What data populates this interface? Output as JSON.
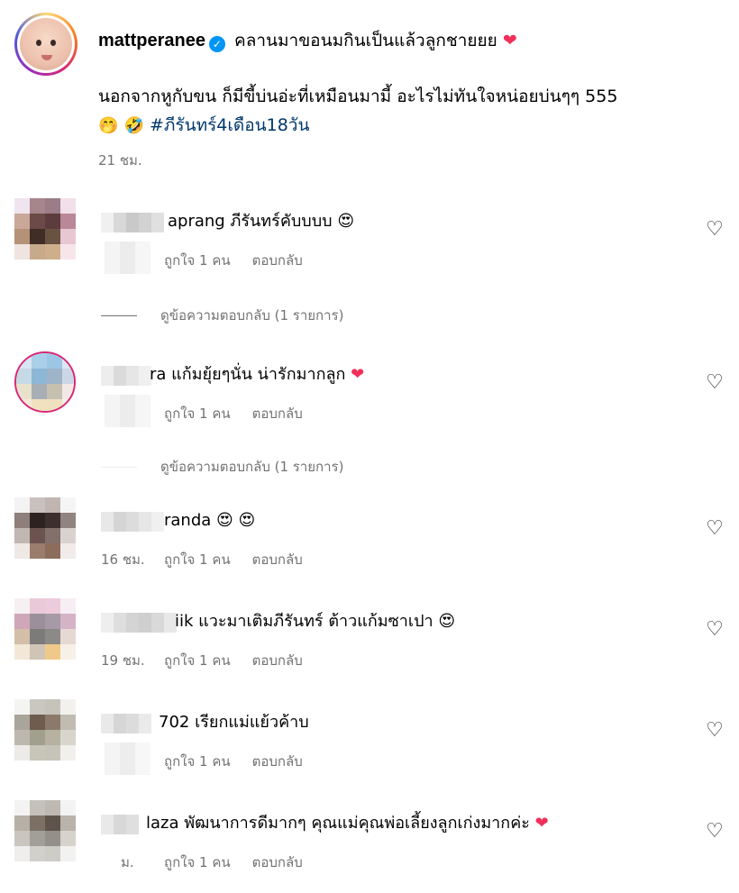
{
  "post": {
    "username": "mattperanee",
    "verified_icon": "verified-badge-icon",
    "caption_line1": "คลานมาขอนมกินเป็นแล้วลูกชายยย",
    "caption_line1_emoji": "❤",
    "caption_line2": "นอกจากหูกับขน ก็มีขี้บ่นอ่ะที่เหมือนมามี้ อะไรไม่ทันใจหน่อยบ่นๆๆ 555",
    "caption_emoji_1": "🤭",
    "caption_emoji_2": "🤣",
    "hashtag": "#ภีรันทร์4เดือน18วัน",
    "time": "21 ชม."
  },
  "comments": [
    {
      "name_suffix": "aprang",
      "text": "ภีรันทร์คับบบบ",
      "emoji": "😍",
      "time": "",
      "likes": "ถูกใจ 1 คน",
      "reply": "ตอบกลับ",
      "view_replies": "ดูข้อความตอบกลับ (1 รายการ)"
    },
    {
      "name_suffix": "ra",
      "text": "แก้มยุ้ยๆนั่น น่ารักมากลูก",
      "emoji": "❤",
      "time": "",
      "likes": "ถูกใจ 1 คน",
      "reply": "ตอบกลับ",
      "view_replies": "ดูข้อความตอบกลับ (1 รายการ)"
    },
    {
      "name_suffix": "randa",
      "text": "",
      "emoji": "😍 😍",
      "time": "16 ชม.",
      "likes": "ถูกใจ 1 คน",
      "reply": "ตอบกลับ"
    },
    {
      "name_suffix": "iik",
      "text": "แวะมาเติมภีรันทร์ ต้าวแก้มซาเปา",
      "emoji": "😍",
      "time": "19 ชม.",
      "likes": "ถูกใจ 1 คน",
      "reply": "ตอบกลับ"
    },
    {
      "name_suffix": "702",
      "text": "เรียกแม่แย้วค้าบ",
      "emoji": "",
      "time": "",
      "likes": "ถูกใจ 1 คน",
      "reply": "ตอบกลับ"
    },
    {
      "name_suffix": "laza",
      "text": "พัฒนาการดีมากๆ คุณแม่คุณพ่อเลี้ยงลูกเก่งมากค่ะ",
      "emoji": "❤",
      "time": "ม.",
      "likes": "ถูกใจ 1 คน",
      "reply": "ตอบกลับ"
    }
  ],
  "icons": {
    "like": "heart-outline-icon"
  },
  "colors": {
    "meta_gray": "#737373",
    "hashtag_blue": "#00376b",
    "heart_red": "#f0305a",
    "verified_blue": "#0095f6"
  }
}
